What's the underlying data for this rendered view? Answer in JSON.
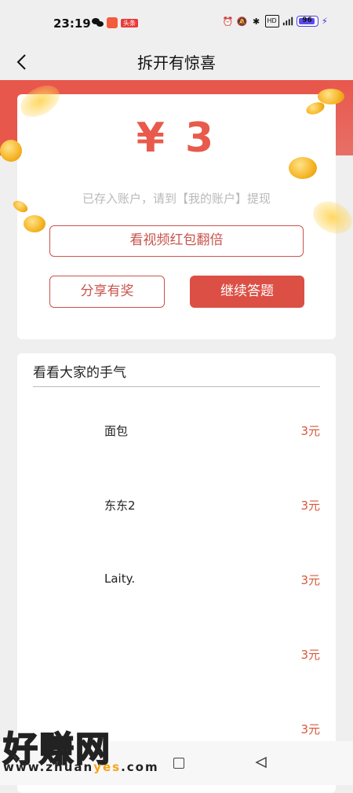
{
  "status_bar": {
    "time": "23:19",
    "news_badge": "头条",
    "battery_level": "96",
    "icons": [
      "wechat-icon",
      "app-badge-icon",
      "alarm-icon",
      "mute-icon",
      "bluetooth-icon",
      "hd-icon",
      "5g-signal-icon",
      "battery-icon",
      "charging-icon"
    ]
  },
  "nav": {
    "title": "拆开有惊喜",
    "back_icon": "chevron-left-icon"
  },
  "prize": {
    "amount": "¥ 3",
    "note": "已存入账户，请到【我的账户】提现",
    "double_label": "看视频红包翻倍",
    "share_label": "分享有奖",
    "continue_label": "继续答题"
  },
  "luck": {
    "title": "看看大家的手气",
    "rows": [
      {
        "name": "面包",
        "amount": "3元"
      },
      {
        "name": "东东2",
        "amount": "3元"
      },
      {
        "name": "Laity.",
        "amount": "3元"
      },
      {
        "name": "",
        "amount": "3元"
      },
      {
        "name": "",
        "amount": "3元"
      }
    ]
  },
  "watermark": {
    "big": "好赚网",
    "url_pre": "www.zhuan",
    "url_hl": "yes",
    "url_post": ".com"
  },
  "colors": {
    "accent": "#e85a4b",
    "button_red": "#dc4f45",
    "band_red": "#e8574c"
  }
}
